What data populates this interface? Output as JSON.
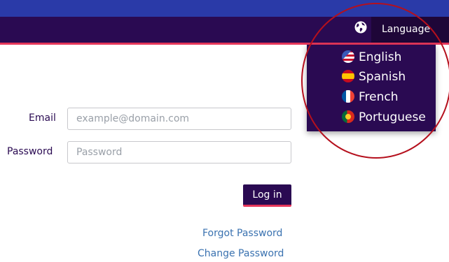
{
  "header": {
    "language_label": "Language",
    "globe_icon": "globe-icon"
  },
  "language_menu": {
    "items": [
      {
        "label": "English",
        "flag": "flag-us-icon"
      },
      {
        "label": "Spanish",
        "flag": "flag-es-icon"
      },
      {
        "label": "French",
        "flag": "flag-fr-icon"
      },
      {
        "label": "Portuguese",
        "flag": "flag-pt-icon"
      }
    ]
  },
  "login_form": {
    "email_label": "Email",
    "email_placeholder": "example@domain.com",
    "password_label": "Password",
    "password_placeholder": "Password",
    "submit_label": "Log in",
    "forgot_password": "Forgot Password",
    "change_password": "Change Password"
  },
  "colors": {
    "top_strip": "#2a3aa8",
    "navbar": "#2a0a52",
    "accent": "#e5365a",
    "link": "#3a72b0",
    "highlight_circle": "#b5101d"
  }
}
